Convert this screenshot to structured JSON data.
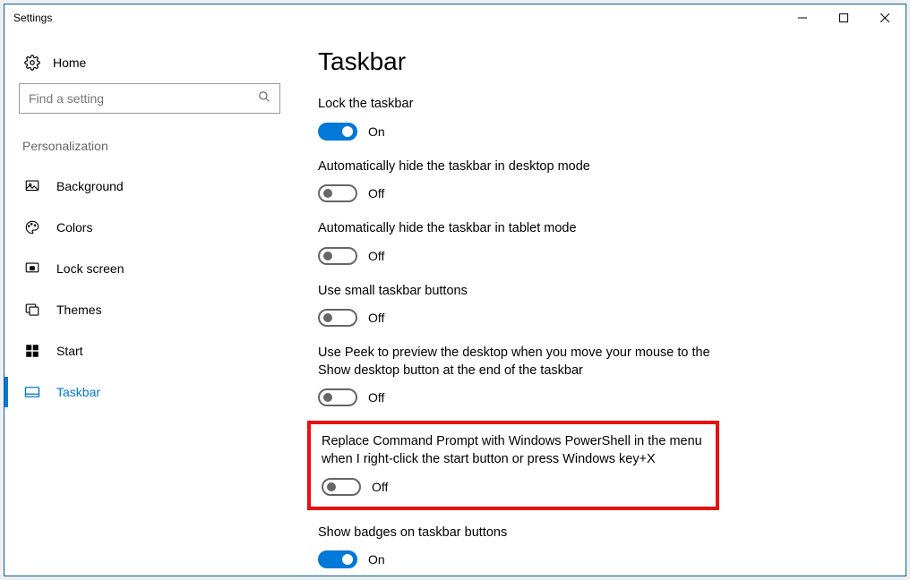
{
  "window": {
    "title": "Settings"
  },
  "sidebar": {
    "home": "Home",
    "search_placeholder": "Find a setting",
    "section": "Personalization",
    "items": [
      {
        "label": "Background"
      },
      {
        "label": "Colors"
      },
      {
        "label": "Lock screen"
      },
      {
        "label": "Themes"
      },
      {
        "label": "Start"
      },
      {
        "label": "Taskbar"
      }
    ]
  },
  "main": {
    "heading": "Taskbar",
    "settings": [
      {
        "label": "Lock the taskbar",
        "state": "On",
        "on": true
      },
      {
        "label": "Automatically hide the taskbar in desktop mode",
        "state": "Off",
        "on": false
      },
      {
        "label": "Automatically hide the taskbar in tablet mode",
        "state": "Off",
        "on": false
      },
      {
        "label": "Use small taskbar buttons",
        "state": "Off",
        "on": false
      },
      {
        "label": "Use Peek to preview the desktop when you move your mouse to the Show desktop button at the end of the taskbar",
        "state": "Off",
        "on": false
      },
      {
        "label": "Replace Command Prompt with Windows PowerShell in the menu when I right-click the start button or press Windows key+X",
        "state": "Off",
        "on": false
      },
      {
        "label": "Show badges on taskbar buttons",
        "state": "On",
        "on": true
      }
    ]
  },
  "colors": {
    "accent": "#0078d7",
    "highlight": "#e91010"
  }
}
